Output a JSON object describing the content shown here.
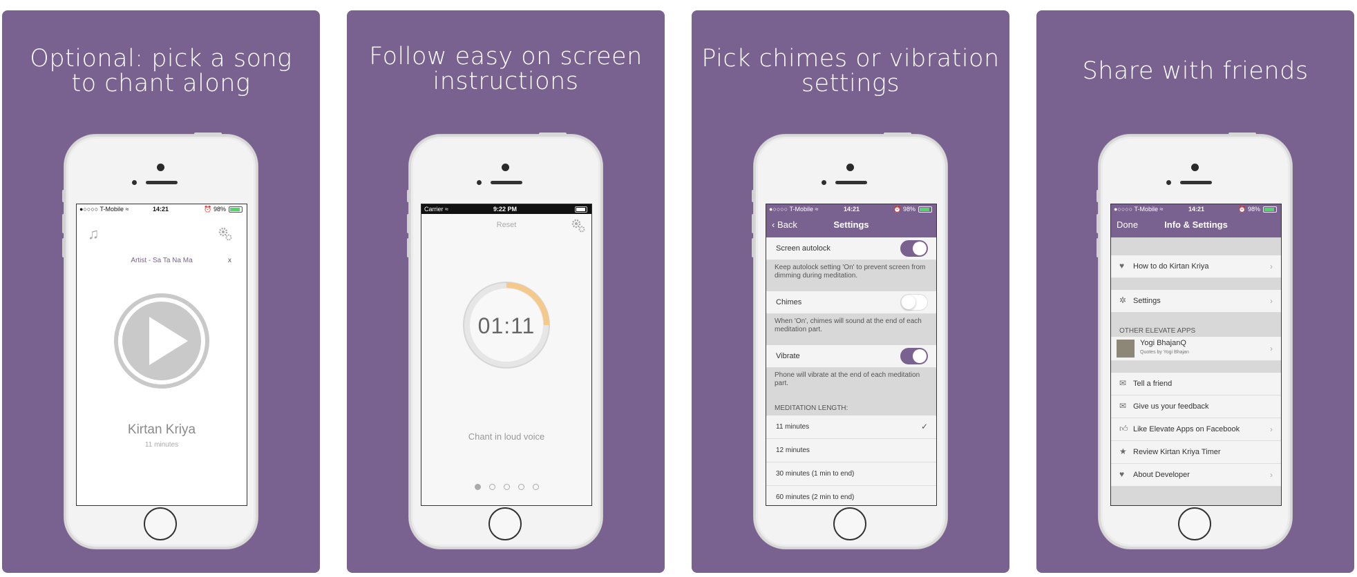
{
  "panels": [
    {
      "headline_line1": "Optional: pick a song",
      "headline_line2": "to chant along",
      "status": {
        "carrier": "●○○○○ T-Mobile ≈",
        "time": "14:21",
        "battery": "⏰ 98%"
      },
      "music_icon": "music-note-icon",
      "gear_icon": "gears-icon",
      "song_title": "Artist - Sa Ta Na Ma",
      "song_remove": "x",
      "play_icon": "play-icon",
      "session_title": "Kirtan Kriya",
      "session_length": "11 minutes"
    },
    {
      "headline_line1": "Follow easy on screen",
      "headline_line2": "instructions",
      "status": {
        "carrier": "Carrier ≈",
        "time": "9:22 PM"
      },
      "reset_label": "Reset",
      "timer": "01:11",
      "timer_progress": 0.25,
      "instruction": "Chant in loud voice",
      "page_dots": 5,
      "active_dot": 1
    },
    {
      "headline_line1": "Pick chimes or vibration",
      "headline_line2": "settings",
      "status": {
        "carrier": "●○○○○ T-Mobile ≈",
        "time": "14:21",
        "battery": "⏰ 98%"
      },
      "back_label": "Back",
      "title": "Settings",
      "autolock": {
        "label": "Screen autolock",
        "on": true,
        "footer": "Keep autolock setting 'On' to prevent screen from dimming during meditation."
      },
      "chimes": {
        "label": "Chimes",
        "on": false,
        "footer": "When 'On', chimes will sound at the end of each meditation part."
      },
      "vibrate": {
        "label": "Vibrate",
        "on": true,
        "footer": "Phone will vibrate at the end of each meditation part."
      },
      "length_header": "MEDITATION LENGTH:",
      "lengths": [
        "11 minutes",
        "12 minutes",
        "30 minutes (1 min to end)",
        "60 minutes (2 min to end)"
      ],
      "selected_length": "11 minutes",
      "check": "✓"
    },
    {
      "headline_line1": "Share with friends",
      "status": {
        "carrier": "●○○○○ T-Mobile ≈",
        "time": "14:21",
        "battery": "⏰ 98%"
      },
      "done_label": "Done",
      "title": "Info & Settings",
      "how_to": "How to do Kirtan Kriya",
      "settings": "Settings",
      "other_header": "OTHER ELEVATE APPS",
      "app_name": "Yogi BhajanQ",
      "app_sub": "Quotes by Yogi Bhajan",
      "tell_friend": "Tell a friend",
      "feedback": "Give us your feedback",
      "like_fb": "Like Elevate Apps on Facebook",
      "review": "Review Kirtan Kriya Timer",
      "about": "About Developer"
    }
  ],
  "colors": {
    "accent": "#7a6290",
    "timer_ring": "#f5c98a"
  }
}
